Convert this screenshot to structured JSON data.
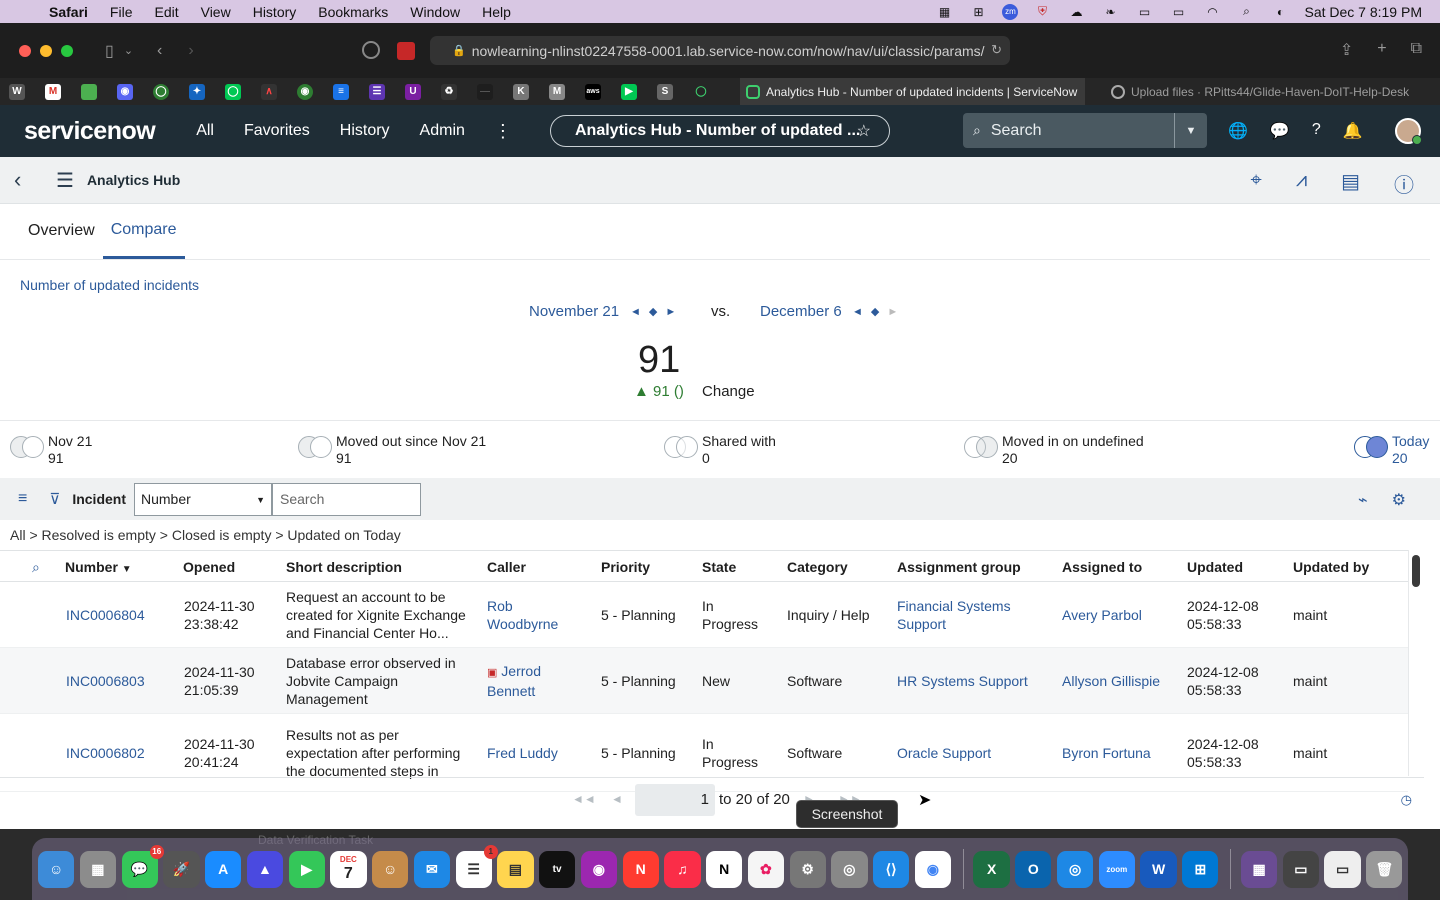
{
  "menubar": {
    "app": "Safari",
    "items": [
      "File",
      "Edit",
      "View",
      "History",
      "Bookmarks",
      "Window",
      "Help"
    ],
    "clock": "Sat Dec 7  8:19 PM"
  },
  "safari": {
    "url": "nowlearning-nlinst02247558-0001.lab.service-now.com/now/nav/ui/classic/params/"
  },
  "tabs": {
    "active": "Analytics Hub - Number of updated incidents | ServiceNow",
    "inactive": "Upload files · RPitts44/Glide-Haven-DoIT-Help-Desk"
  },
  "sn_header": {
    "logo": "servicenow",
    "nav": [
      "All",
      "Favorites",
      "History",
      "Admin"
    ],
    "context_title": "Analytics Hub - Number of updated ...",
    "search_placeholder": "Search"
  },
  "hub": {
    "title": "Analytics Hub",
    "tabs": [
      "Overview",
      "Compare"
    ],
    "indicator": "Number of updated incidents",
    "date1": "November 21",
    "vs": "vs.",
    "date2": "December 6",
    "score": "91",
    "change_value": "▲ 91 ()",
    "change_label": "Change"
  },
  "venn": [
    {
      "label": "Nov 21",
      "value": "91"
    },
    {
      "label": "Moved out since Nov 21",
      "value": "91"
    },
    {
      "label": "Shared with",
      "value": "0"
    },
    {
      "label": "Moved in on undefined",
      "value": "20"
    },
    {
      "label": "Today",
      "value": "20"
    }
  ],
  "list": {
    "table_label": "Incident",
    "field_select": "Number",
    "search_placeholder": "Search",
    "breadcrumb": "All > Resolved is empty > Closed is empty > Updated on Today",
    "columns": [
      "Number",
      "Opened",
      "Short description",
      "Caller",
      "Priority",
      "State",
      "Category",
      "Assignment group",
      "Assigned to",
      "Updated",
      "Updated by"
    ],
    "rows": [
      {
        "number": "INC0006804",
        "opened_date": "2024-11-30",
        "opened_time": "23:38:42",
        "desc": [
          "Request an account to be",
          "created for Xignite Exchange",
          "and Financial Center Ho..."
        ],
        "caller": [
          "Rob",
          "Woodbyrne"
        ],
        "priority": "5 - Planning",
        "state": [
          "In",
          "Progress"
        ],
        "category": "Inquiry / Help",
        "group": [
          "Financial Systems",
          "Support"
        ],
        "assigned": "Avery Parbol",
        "updated_date": "2024-12-08",
        "updated_time": "05:58:33",
        "updated_by": "maint"
      },
      {
        "number": "INC0006803",
        "opened_date": "2024-11-30",
        "opened_time": "21:05:39",
        "desc": [
          "Database error observed in",
          "Jobvite Campaign",
          "Management"
        ],
        "caller": [
          "Jerrod",
          "Bennett"
        ],
        "priority": "5 - Planning",
        "state": [
          "New",
          ""
        ],
        "category": "Software",
        "group": [
          "HR Systems Support",
          ""
        ],
        "assigned": "Allyson Gillispie",
        "updated_date": "2024-12-08",
        "updated_time": "05:58:33",
        "updated_by": "maint"
      },
      {
        "number": "INC0006802",
        "opened_date": "2024-11-30",
        "opened_time": "20:41:24",
        "desc": [
          "Results not as per",
          "expectation after performing",
          "the documented steps in"
        ],
        "caller": [
          "Fred Luddy",
          ""
        ],
        "priority": "5 - Planning",
        "state": [
          "In",
          "Progress"
        ],
        "category": "Software",
        "group": [
          "Oracle Support",
          ""
        ],
        "assigned": "Byron Fortuna",
        "updated_date": "2024-12-08",
        "updated_time": "05:58:33",
        "updated_by": "maint"
      }
    ],
    "pager_page": "1",
    "pager_text": "to 20 of 20"
  },
  "overlay": {
    "tooltip": "Screenshot",
    "obscured_text": "Data Verification Task"
  },
  "dock": {
    "messages_badge": "16",
    "reminders_badge": "1",
    "calendar_month": "DEC",
    "calendar_day": "7"
  }
}
